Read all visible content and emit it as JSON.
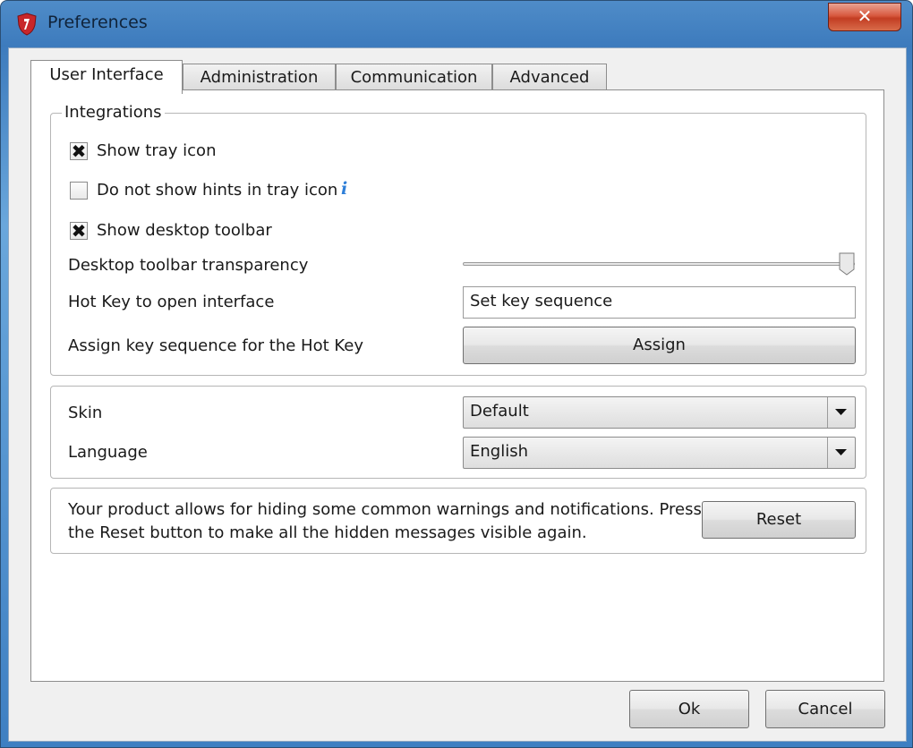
{
  "window": {
    "title": "Preferences",
    "close_glyph": "✕",
    "app_icon": "shield-icon"
  },
  "tabs": [
    {
      "label": "User Interface",
      "active": true
    },
    {
      "label": "Administration",
      "active": false
    },
    {
      "label": "Communication",
      "active": false
    },
    {
      "label": "Advanced",
      "active": false
    }
  ],
  "integrations": {
    "legend": "Integrations",
    "show_tray_icon": {
      "label": "Show tray icon",
      "checked": true
    },
    "no_hints": {
      "label": "Do not show hints in tray icon",
      "checked": false,
      "info_icon": "i"
    },
    "show_desktop_toolbar": {
      "label": "Show desktop toolbar",
      "checked": true
    },
    "transparency": {
      "label": "Desktop toolbar transparency",
      "value_fraction": 1.0
    },
    "hotkey": {
      "label": "Hot Key to open interface",
      "value": "Set key sequence"
    },
    "assign": {
      "label": "Assign key sequence for the Hot Key",
      "button": "Assign"
    }
  },
  "appearance": {
    "skin": {
      "label": "Skin",
      "selected": "Default"
    },
    "language": {
      "label": "Language",
      "selected": "English"
    }
  },
  "reset_section": {
    "text_line1": "Your product allows for hiding some common warnings and notifications. Press",
    "text_line2": "the Reset button to make all the hidden messages visible again.",
    "button": "Reset"
  },
  "footer": {
    "ok": "Ok",
    "cancel": "Cancel"
  },
  "checkbox_mark": "✖",
  "colors": {
    "title_bar": "#3e7fc2",
    "close_button": "#c23d22",
    "info": "#2f7fd8"
  }
}
